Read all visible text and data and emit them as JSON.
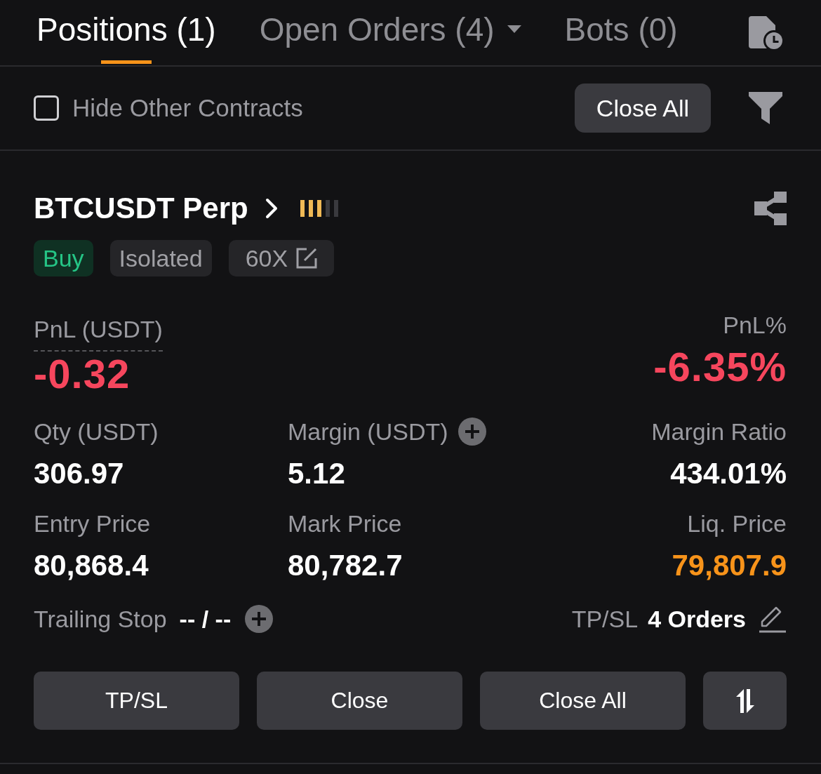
{
  "tabs": [
    {
      "label": "Positions (1)",
      "selected": true,
      "menu": false
    },
    {
      "label": "Open Orders (4)",
      "selected": false,
      "menu": true
    },
    {
      "label": "Bots (0)",
      "selected": false,
      "menu": false
    }
  ],
  "toolbar": {
    "hide_other_contracts": {
      "label": "Hide Other Contracts",
      "checked": false
    },
    "close_all": "Close All"
  },
  "position": {
    "symbol": "BTCUSDT Perp",
    "level": 0.6,
    "tags": [
      {
        "kind": "side",
        "label": "Buy"
      },
      {
        "kind": "mode",
        "label": "Isolated"
      },
      {
        "kind": "leverage",
        "label": "60X"
      }
    ],
    "pnl": {
      "label": "PnL (USDT)",
      "value": "-0.32",
      "loss": true
    },
    "pnl_percent": {
      "label": "PnL%",
      "value": "-6.35%",
      "loss": true
    },
    "stats": [
      {
        "label": "Qty (USDT)",
        "value": "306.97",
        "add": false,
        "highlight": false
      },
      {
        "label": "Margin (USDT)",
        "value": "5.12",
        "add": true,
        "highlight": false
      },
      {
        "label": "Margin Ratio",
        "value": "434.01%",
        "add": false,
        "highlight": false
      },
      {
        "label": "Entry Price",
        "value": "80,868.4",
        "add": false,
        "highlight": false
      },
      {
        "label": "Mark Price",
        "value": "80,782.7",
        "add": false,
        "highlight": false
      },
      {
        "label": "Liq. Price",
        "value": "79,807.9",
        "add": false,
        "highlight": true
      }
    ],
    "trailing_stop": {
      "label": "Trailing Stop",
      "value": "-- / --"
    },
    "tp_sl": {
      "label": "TP/SL",
      "value": "4 Orders"
    },
    "actions": [
      "TP/SL",
      "Close",
      "Close All"
    ]
  }
}
